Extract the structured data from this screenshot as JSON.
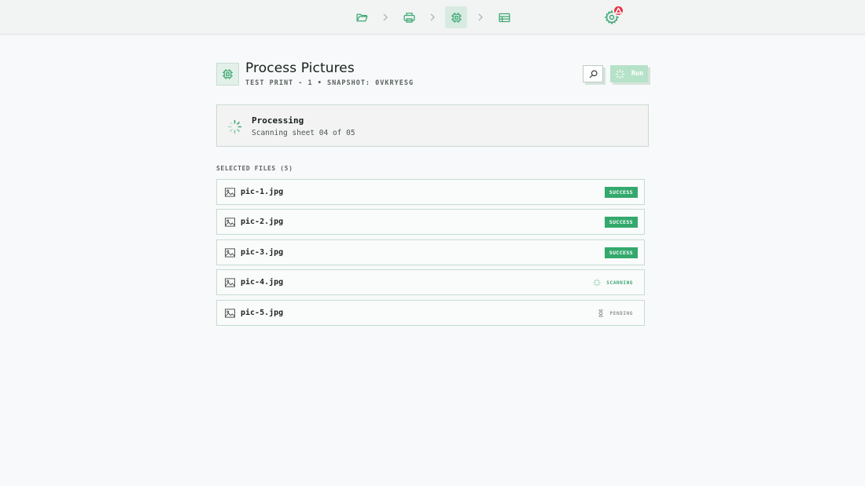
{
  "nav": {
    "steps": [
      {
        "name": "open-files",
        "icon": "folder-open-icon",
        "active": false
      },
      {
        "name": "print",
        "icon": "printer-icon",
        "active": false
      },
      {
        "name": "process",
        "icon": "cpu-chip-icon",
        "active": true
      },
      {
        "name": "results",
        "icon": "table-icon",
        "active": false
      }
    ],
    "settings_icon": "gear-icon",
    "alert_icon": "warning-triangle-icon"
  },
  "header": {
    "icon": "cpu-chip-icon",
    "title": "Process Pictures",
    "subtitle": "TEST PRINT - 1 • SNAPSHOT: 0VKRYESG",
    "search_icon": "search-icon",
    "run_label": "Run",
    "run_icon": "spinner-icon"
  },
  "status": {
    "title": "Processing",
    "detail": "Scanning sheet 04 of 05"
  },
  "files": {
    "label": "SELECTED FILES (5)",
    "items": [
      {
        "name": "pic-1.jpg",
        "status": "SUCCESS"
      },
      {
        "name": "pic-2.jpg",
        "status": "SUCCESS"
      },
      {
        "name": "pic-3.jpg",
        "status": "SUCCESS"
      },
      {
        "name": "pic-4.jpg",
        "status": "SCANNING"
      },
      {
        "name": "pic-5.jpg",
        "status": "PENDING"
      }
    ]
  },
  "colors": {
    "accent": "#34a96d",
    "accent_light": "#b5e2c8",
    "alert": "#e8334a"
  }
}
